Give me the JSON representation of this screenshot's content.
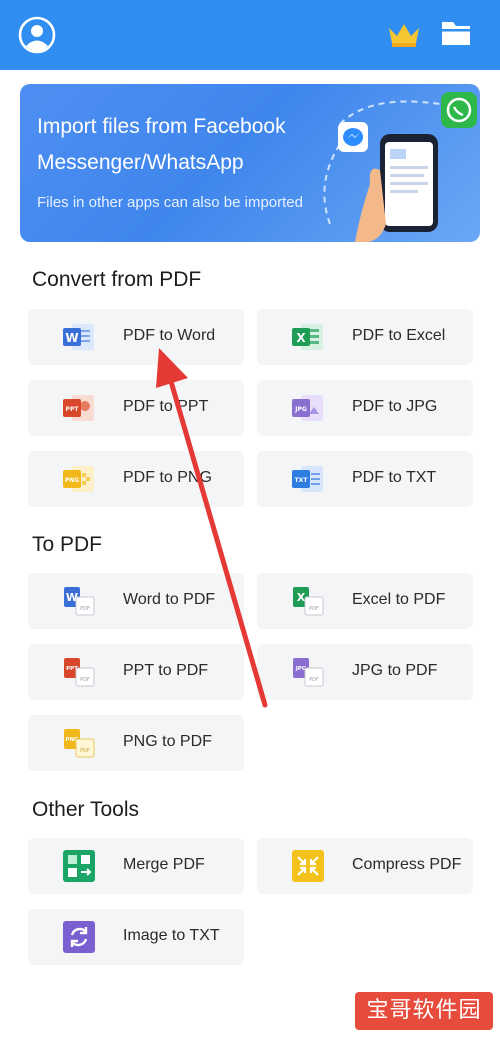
{
  "banner": {
    "line1": "Import files from Facebook",
    "line2": "Messenger/WhatsApp",
    "line3": "Files in other apps can also be imported"
  },
  "sections": {
    "convert_from_pdf": "Convert from PDF",
    "to_pdf": "To PDF",
    "other_tools": "Other Tools"
  },
  "tools": {
    "pdf_to_word": "PDF to Word",
    "pdf_to_excel": "PDF to Excel",
    "pdf_to_ppt": "PDF to PPT",
    "pdf_to_jpg": "PDF to JPG",
    "pdf_to_png": "PDF to PNG",
    "pdf_to_txt": "PDF to TXT",
    "word_to_pdf": "Word to PDF",
    "excel_to_pdf": "Excel to PDF",
    "ppt_to_pdf": "PPT to PDF",
    "jpg_to_pdf": "JPG to PDF",
    "png_to_pdf": "PNG to PDF",
    "merge_pdf": "Merge PDF",
    "compress_pdf": "Compress PDF",
    "image_to_txt": "Image to TXT"
  },
  "icon_badges": {
    "word": "W",
    "excel": "X",
    "ppt": "PPT",
    "jpg": "JPG",
    "png": "PNG",
    "txt": "TXT",
    "pdf": "PDF"
  },
  "watermark": "宝哥软件园",
  "icons": {
    "top_left": "user-avatar-icon",
    "top_right_1": "crown-icon",
    "top_right_2": "folder-icon"
  },
  "colors": {
    "topbar": "#2f8ef0",
    "word": "#3a6fd8",
    "excel": "#1f9d57",
    "ppt": "#d9472b",
    "jpg": "#8a6fd1",
    "png": "#f0b81a",
    "txt": "#2f7de1",
    "merge": "#1aa567",
    "compress": "#f2c21a",
    "image_to_txt": "#7a5fd0",
    "arrow": "#e53935"
  }
}
